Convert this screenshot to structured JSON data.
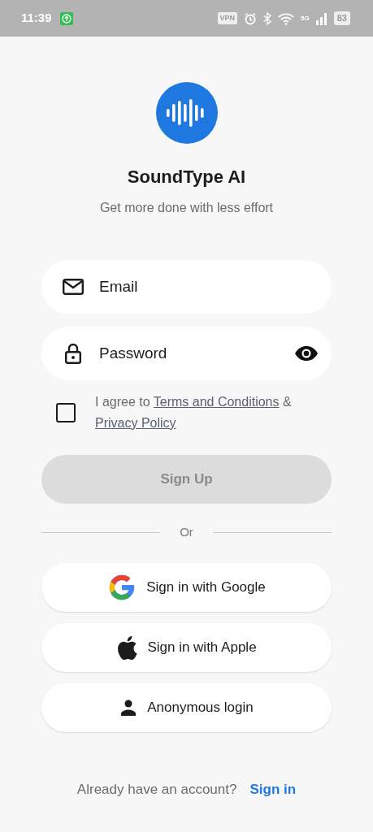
{
  "status_bar": {
    "time": "11:39",
    "vpn": "VPN",
    "network": "5G",
    "battery": "83"
  },
  "app": {
    "title": "SoundType AI",
    "tagline": "Get more done with less effort"
  },
  "fields": [
    {
      "kind": "email",
      "placeholder": "Email"
    },
    {
      "kind": "password",
      "placeholder": "Password"
    }
  ],
  "agreement": {
    "checked": false,
    "prefix": "I agree to ",
    "terms_link": "Terms and Conditions",
    "joiner": " & ",
    "privacy_link": "Privacy Policy"
  },
  "signup_button": {
    "label": "Sign Up",
    "disabled": true
  },
  "divider": "Or",
  "social_buttons": [
    {
      "kind": "google",
      "label": "Sign in with Google"
    },
    {
      "kind": "apple",
      "label": "Sign in with Apple"
    },
    {
      "kind": "anonymous",
      "label": "Anonymous login"
    }
  ],
  "footer": {
    "text": "Already have an account?",
    "link": "Sign in"
  }
}
